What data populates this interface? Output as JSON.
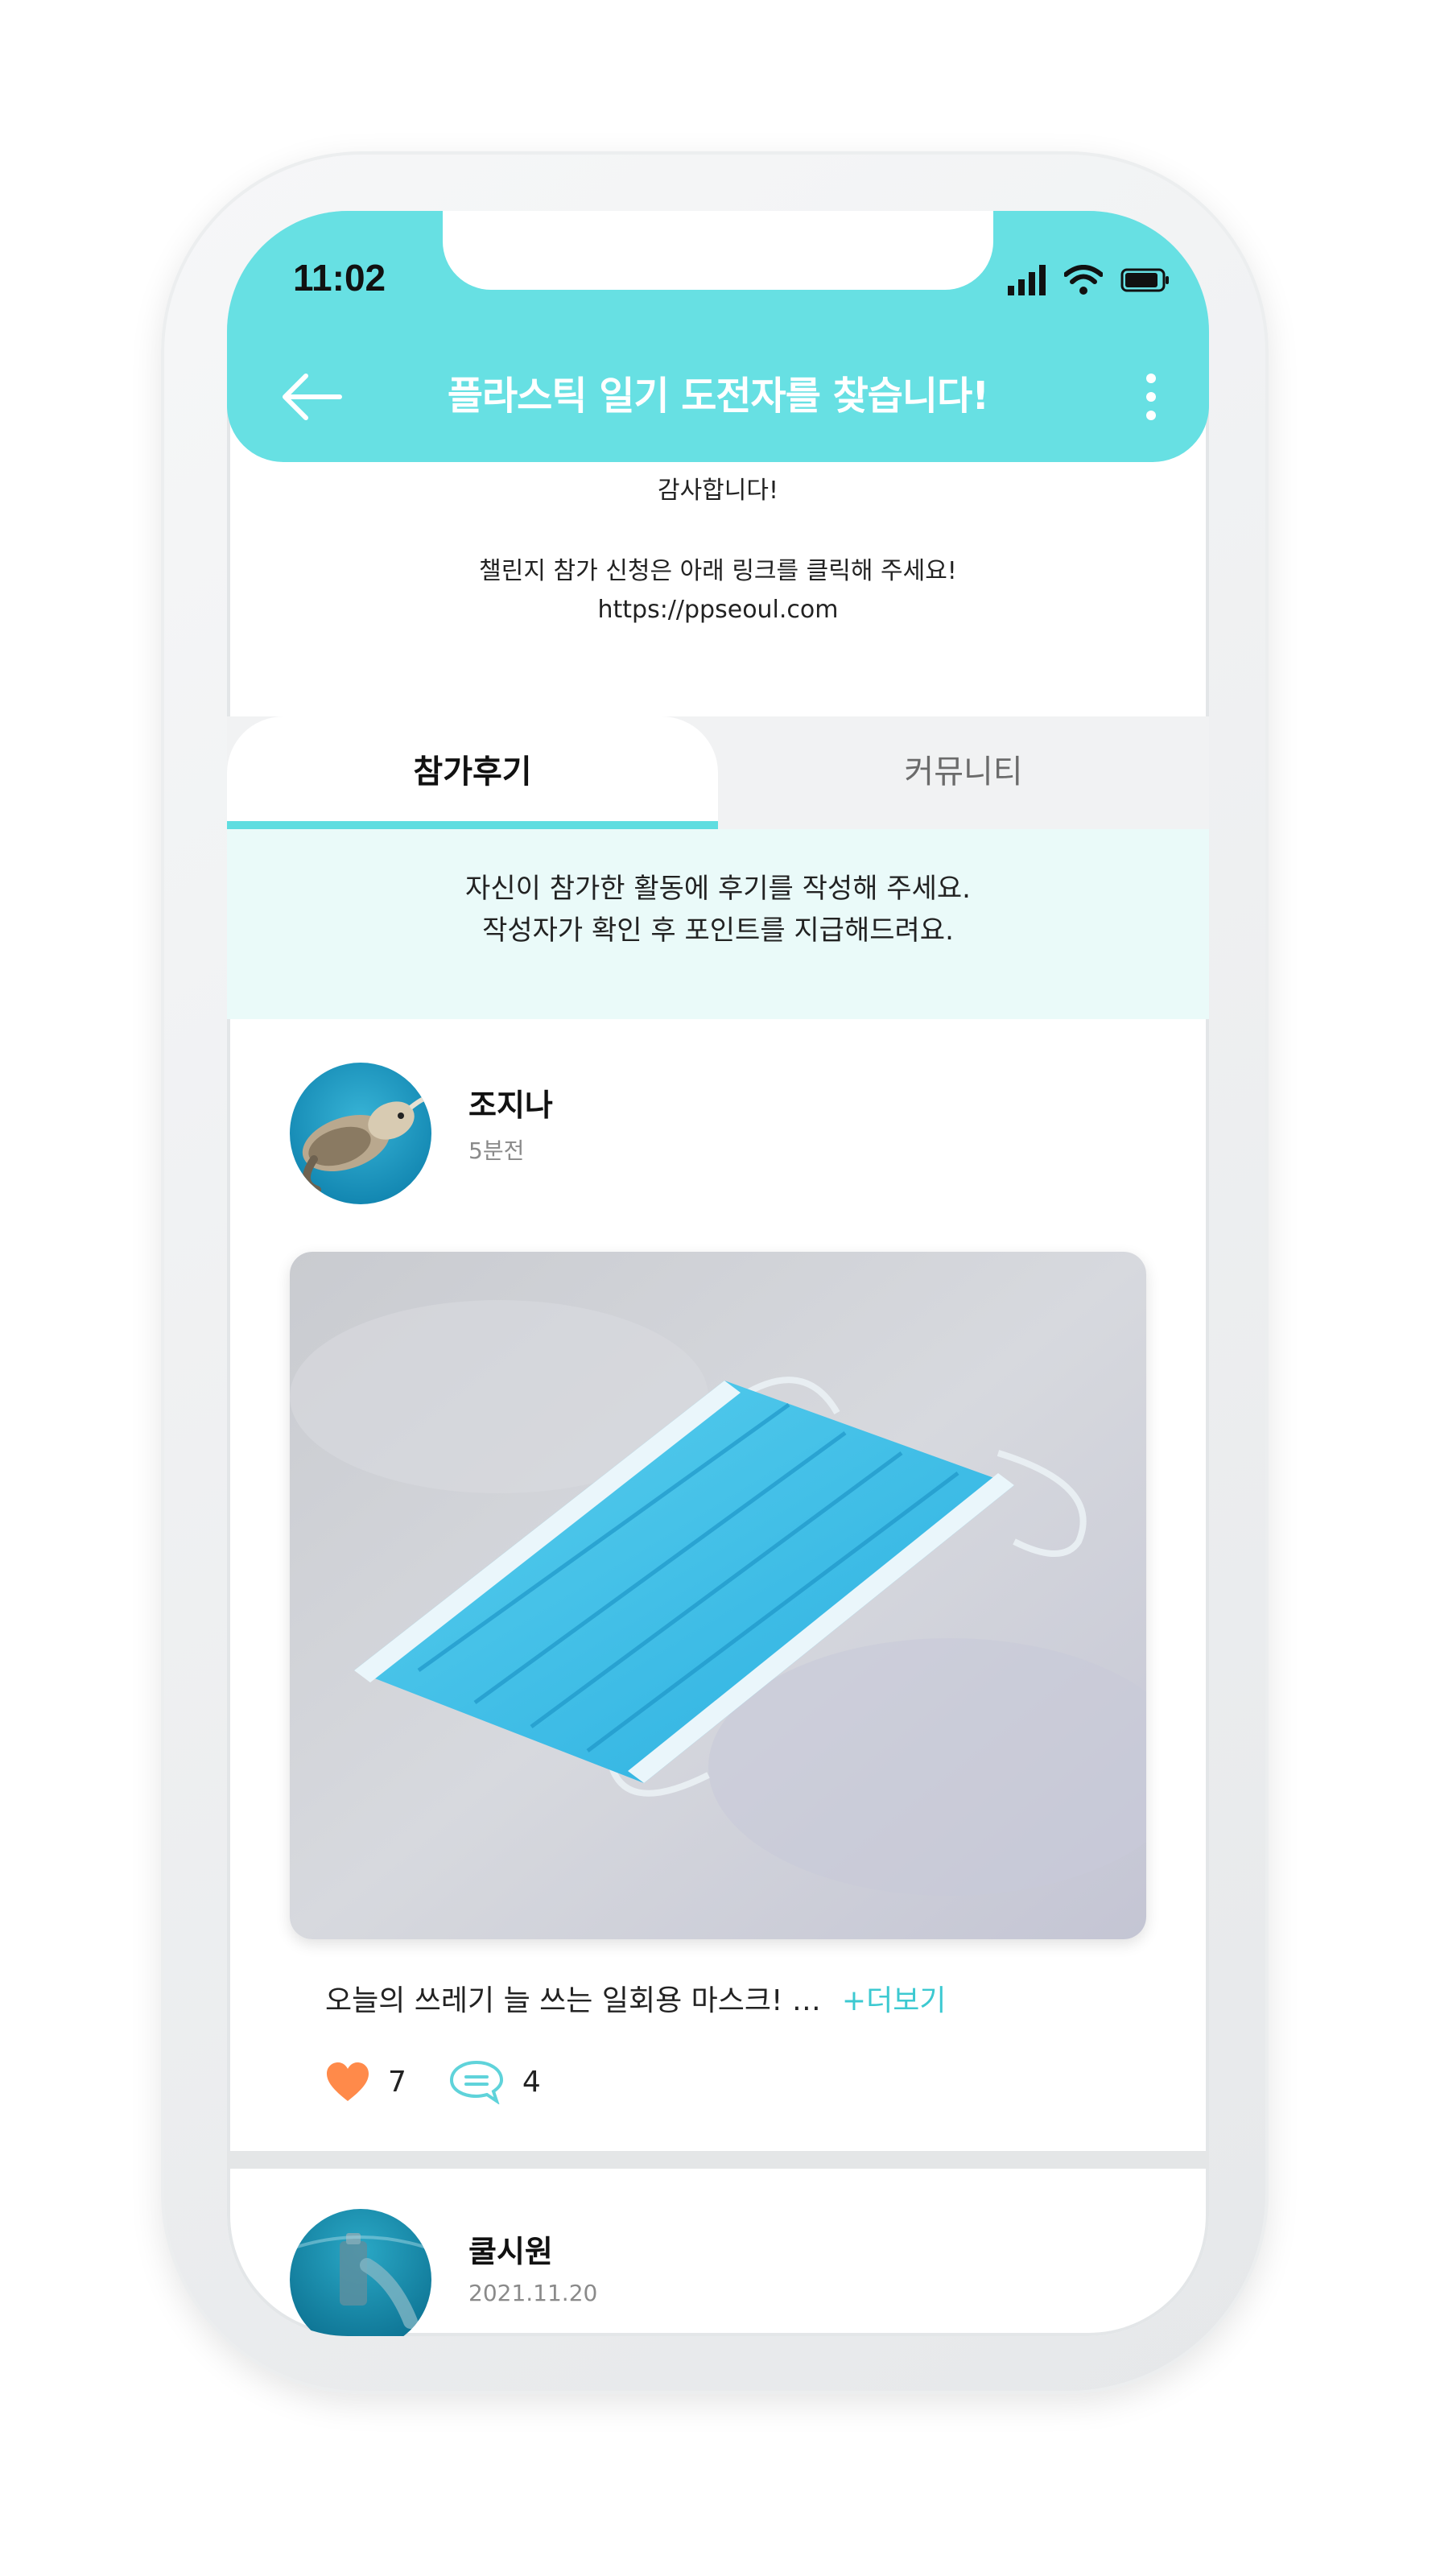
{
  "status_bar": {
    "time": "11:02"
  },
  "app_bar": {
    "title": "플라스틱 일기 도전자를 찾습니다!"
  },
  "intro": {
    "thanks": "감사합니다!",
    "apply_text": "챌린지 참가 신청은 아래 링크를 클릭해 주세요!",
    "link": "https://ppseoul.com"
  },
  "tabs": [
    {
      "label": "참가후기",
      "active": true
    },
    {
      "label": "커뮤니티",
      "active": false
    }
  ],
  "notice": {
    "line1": "자신이 참가한 활동에 후기를 작성해 주세요.",
    "line2": "작성자가 확인 후 포인트를 지급해드려요."
  },
  "posts": [
    {
      "author": "조지나",
      "time": "5분전",
      "caption": "오늘의 쓰레기 늘 쓰는 일회용 마스크! …",
      "more_label": "+더보기",
      "likes": "7",
      "comments": "4"
    },
    {
      "author": "쿨시원",
      "time": "2021.11.20"
    }
  ],
  "colors": {
    "accent": "#67e0e3",
    "heart": "#ff8a4a",
    "link": "#3cc9d1"
  },
  "icons": [
    "back-arrow-icon",
    "more-vertical-icon",
    "signal-icon",
    "wifi-icon",
    "battery-icon",
    "heart-icon",
    "comment-icon"
  ]
}
